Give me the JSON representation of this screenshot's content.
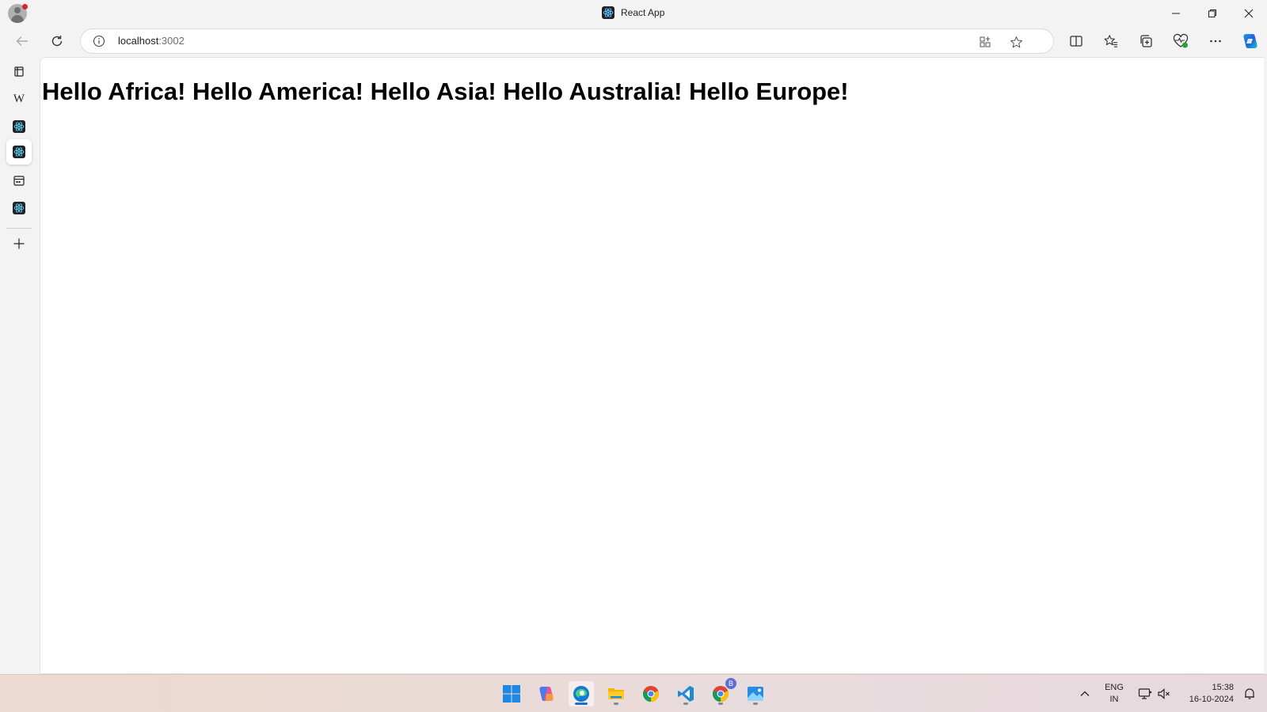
{
  "window": {
    "title": "React App",
    "minimize_glyph": "─",
    "restore_glyph": "❐",
    "close_glyph": "✕"
  },
  "toolbar": {
    "back_icon": "arrow-left-icon",
    "refresh_icon": "refresh-icon",
    "address": {
      "host": "localhost",
      "port": ":3002"
    }
  },
  "sidebar": {
    "items": [
      {
        "name": "tab-actions",
        "icon": "tabs-icon"
      },
      {
        "name": "wikipedia",
        "icon": "wikipedia-icon",
        "glyph": "W"
      },
      {
        "name": "react-app-tab-1",
        "icon": "react-icon"
      },
      {
        "name": "react-app-tab-2",
        "icon": "react-icon",
        "active": true
      },
      {
        "name": "calendar",
        "icon": "calendar-icon"
      },
      {
        "name": "react-app-tab-3",
        "icon": "react-icon"
      },
      {
        "name": "add-tab",
        "icon": "plus-icon"
      }
    ]
  },
  "page": {
    "heading": "Hello Africa! Hello America! Hello Asia! Hello Australia! Hello Europe!"
  },
  "taskbar": {
    "apps": [
      "start",
      "copilot",
      "edge",
      "file-explorer",
      "chrome",
      "vscode",
      "chrome-profile",
      "photos"
    ],
    "chrome_profile_badge": "B",
    "tray": {
      "lang_top": "ENG",
      "lang_bottom": "IN",
      "time": "15:38",
      "date": "16-10-2024"
    }
  },
  "colors": {
    "accent": "#1a6fd1",
    "react_bg": "#20232a",
    "react_atom": "#61dafb"
  }
}
